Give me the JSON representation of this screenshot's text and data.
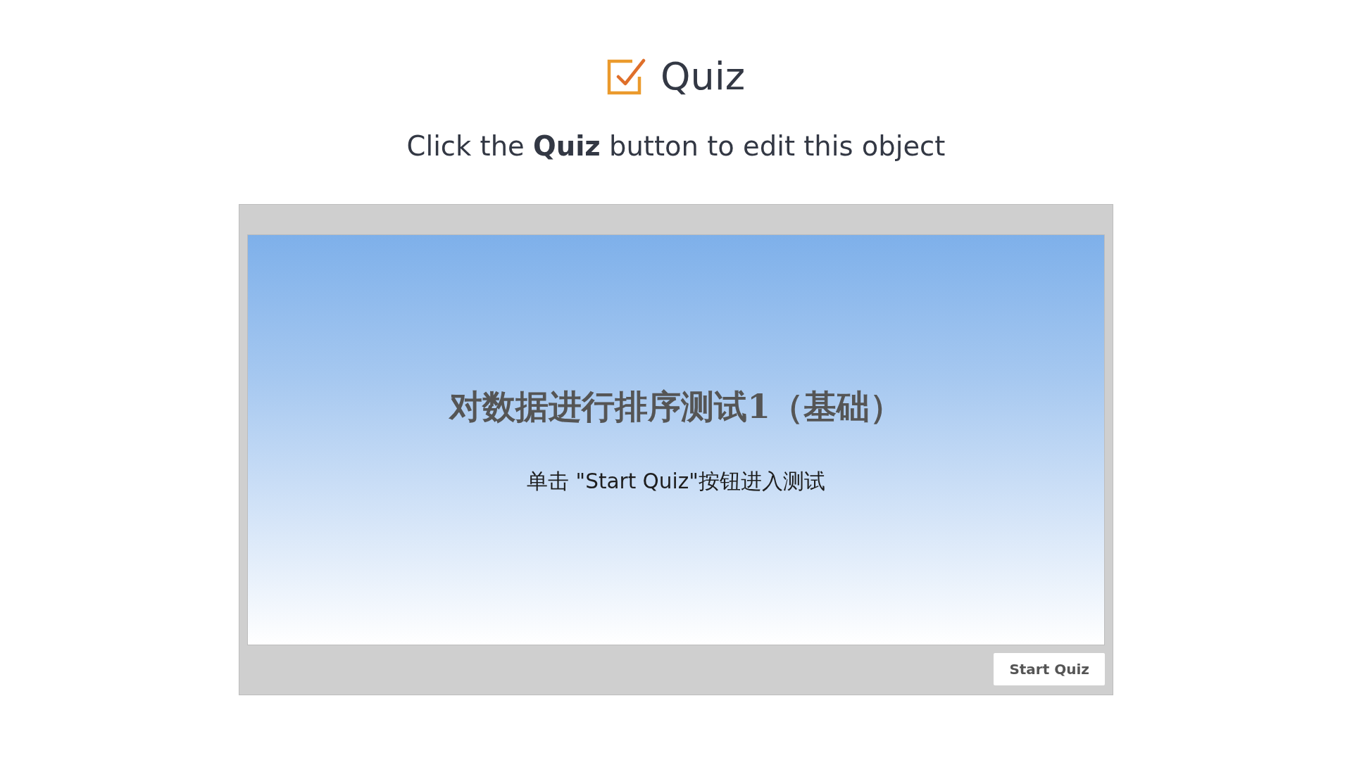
{
  "header": {
    "title": "Quiz",
    "subtitle": "Click the **Quiz** button to edit this object"
  },
  "slide": {
    "title": "对数据进行排序测试1（基础）",
    "instruction": "单击 \"Start Quiz\"按钮进入测试"
  },
  "buttons": [
    "Start Quiz"
  ]
}
